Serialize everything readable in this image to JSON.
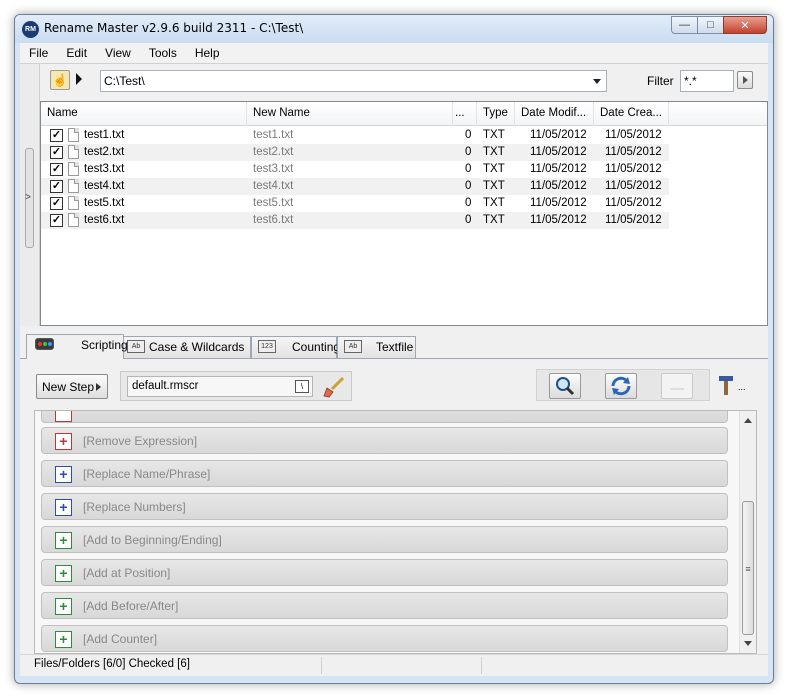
{
  "window": {
    "title": "Rename Master v2.9.6 build 2311 - C:\\Test\\",
    "app_icon_text": "RM"
  },
  "menu": [
    "File",
    "Edit",
    "View",
    "Tools",
    "Help"
  ],
  "pathbar": {
    "path": "C:\\Test\\",
    "filter_label": "Filter",
    "filter_value": "*.*"
  },
  "filelist": {
    "columns": [
      "Name",
      "New Name",
      "...",
      "Type",
      "Date Modif...",
      "Date Crea..."
    ],
    "rows": [
      {
        "name": "test1.txt",
        "new_name": "test1.txt",
        "size": "0",
        "type": "TXT",
        "modified": "11/05/2012",
        "created": "11/05/2012",
        "checked": true
      },
      {
        "name": "test2.txt",
        "new_name": "test2.txt",
        "size": "0",
        "type": "TXT",
        "modified": "11/05/2012",
        "created": "11/05/2012",
        "checked": true
      },
      {
        "name": "test3.txt",
        "new_name": "test3.txt",
        "size": "0",
        "type": "TXT",
        "modified": "11/05/2012",
        "created": "11/05/2012",
        "checked": true
      },
      {
        "name": "test4.txt",
        "new_name": "test4.txt",
        "size": "0",
        "type": "TXT",
        "modified": "11/05/2012",
        "created": "11/05/2012",
        "checked": true
      },
      {
        "name": "test5.txt",
        "new_name": "test5.txt",
        "size": "0",
        "type": "TXT",
        "modified": "11/05/2012",
        "created": "11/05/2012",
        "checked": true
      },
      {
        "name": "test6.txt",
        "new_name": "test6.txt",
        "size": "0",
        "type": "TXT",
        "modified": "11/05/2012",
        "created": "11/05/2012",
        "checked": true
      }
    ]
  },
  "tabs": [
    {
      "label": "Scripting",
      "icon": "scripting-leds-icon",
      "active": true
    },
    {
      "label": "Case & Wildcards",
      "icon": "ab-case-icon",
      "active": false
    },
    {
      "label": "Counting",
      "icon": "123-counting-icon",
      "active": false
    },
    {
      "label": "Textfile",
      "icon": "ab-textfile-icon",
      "active": false
    }
  ],
  "scripting": {
    "new_step_label": "New Step",
    "script_file": "default.rmscr",
    "browse_glyph": "\\",
    "tools_ellipsis": "..."
  },
  "steps": [
    {
      "label": "[Remove Expression]",
      "color": "red"
    },
    {
      "label": "[Replace Name/Phrase]",
      "color": "blue"
    },
    {
      "label": "[Replace Numbers]",
      "color": "blue"
    },
    {
      "label": "[Add to Beginning/Ending]",
      "color": "green"
    },
    {
      "label": "[Add at Position]",
      "color": "green"
    },
    {
      "label": "[Add Before/After]",
      "color": "green"
    },
    {
      "label": "[Add Counter]",
      "color": "green"
    }
  ],
  "status": {
    "text": "Files/Folders [6/0] Checked [6]"
  }
}
